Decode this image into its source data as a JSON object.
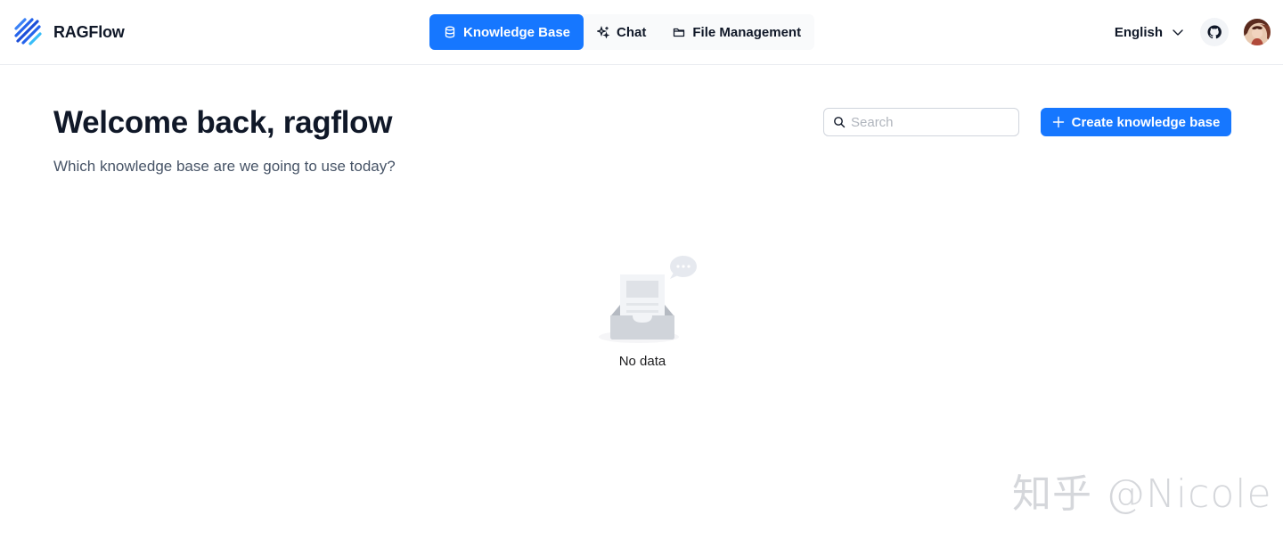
{
  "app": {
    "name": "RAGFlow",
    "accent_color": "#1677ff"
  },
  "nav": {
    "tabs": [
      {
        "label": "Knowledge Base",
        "icon": "database-icon",
        "active": true
      },
      {
        "label": "Chat",
        "icon": "sparkle-icon",
        "active": false
      },
      {
        "label": "File Management",
        "icon": "folder-icon",
        "active": false
      }
    ]
  },
  "header": {
    "language": "English",
    "github_icon": "github-icon",
    "avatar_icon": "user-avatar"
  },
  "main": {
    "title": "Welcome back, ragflow",
    "subtitle": "Which knowledge base are we going to use today?",
    "search": {
      "placeholder": "Search",
      "value": ""
    },
    "create_button": {
      "label": "Create knowledge base",
      "icon": "plus-icon"
    },
    "empty_state": {
      "text": "No data",
      "icon": "empty-inbox-icon"
    }
  },
  "watermark": "知乎 @Nicole"
}
